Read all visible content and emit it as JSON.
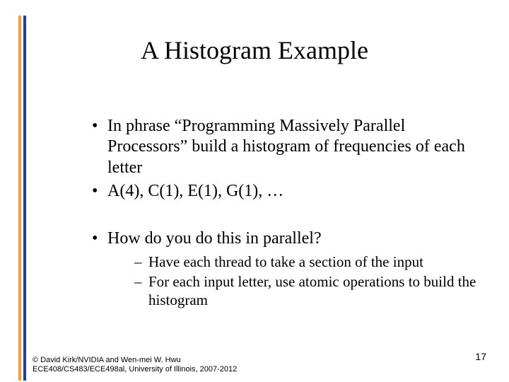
{
  "title": "A Histogram Example",
  "bullets": {
    "b1": "In phrase “Programming Massively Parallel Processors” build a histogram of frequencies of each letter",
    "b2": "A(4), C(1), E(1), G(1), …",
    "b3": "How do you do this in parallel?",
    "sub": {
      "s1": "Have each thread to take a section of the input",
      "s2": "For each input letter, use atomic operations to build the histogram"
    }
  },
  "footer": {
    "credit": "© David Kirk/NVIDIA and Wen-mei W. Hwu ECE408/CS483/ECE498al, University of Illinois, 2007-2012",
    "page": "17"
  }
}
